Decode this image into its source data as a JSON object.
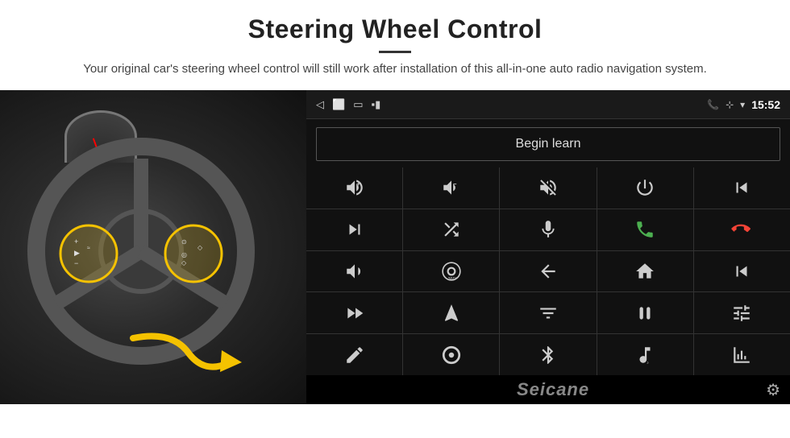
{
  "header": {
    "title": "Steering Wheel Control",
    "description": "Your original car's steering wheel control will still work after installation of this all-in-one auto radio navigation system."
  },
  "status_bar": {
    "time": "15:52",
    "back_icon": "◁",
    "home_icon": "□",
    "square_icon": "▢",
    "signal_icon": "▪▪",
    "phone_icon": "📞",
    "location_icon": "⊹",
    "wifi_icon": "▾"
  },
  "begin_learn": {
    "label": "Begin learn"
  },
  "brand": {
    "name": "Seicane"
  },
  "controls": [
    {
      "id": "vol-up",
      "icon": "vol_up"
    },
    {
      "id": "vol-down",
      "icon": "vol_down"
    },
    {
      "id": "mute",
      "icon": "mute"
    },
    {
      "id": "power",
      "icon": "power"
    },
    {
      "id": "prev-track-phone",
      "icon": "prev_phone"
    },
    {
      "id": "next",
      "icon": "next"
    },
    {
      "id": "shuffle",
      "icon": "shuffle"
    },
    {
      "id": "mic",
      "icon": "mic"
    },
    {
      "id": "phone",
      "icon": "phone"
    },
    {
      "id": "hang-up",
      "icon": "hang_up"
    },
    {
      "id": "horn",
      "icon": "horn"
    },
    {
      "id": "360",
      "icon": "camera_360"
    },
    {
      "id": "back",
      "icon": "back_arrow"
    },
    {
      "id": "home",
      "icon": "home"
    },
    {
      "id": "skip-back",
      "icon": "skip_back"
    },
    {
      "id": "fast-forward",
      "icon": "fast_forward"
    },
    {
      "id": "navigate",
      "icon": "navigate"
    },
    {
      "id": "equalizer",
      "icon": "equalizer"
    },
    {
      "id": "record",
      "icon": "record"
    },
    {
      "id": "sliders",
      "icon": "sliders"
    },
    {
      "id": "pen",
      "icon": "pen"
    },
    {
      "id": "circle",
      "icon": "circle_btn"
    },
    {
      "id": "bluetooth",
      "icon": "bluetooth"
    },
    {
      "id": "music",
      "icon": "music"
    },
    {
      "id": "chart",
      "icon": "chart"
    }
  ]
}
